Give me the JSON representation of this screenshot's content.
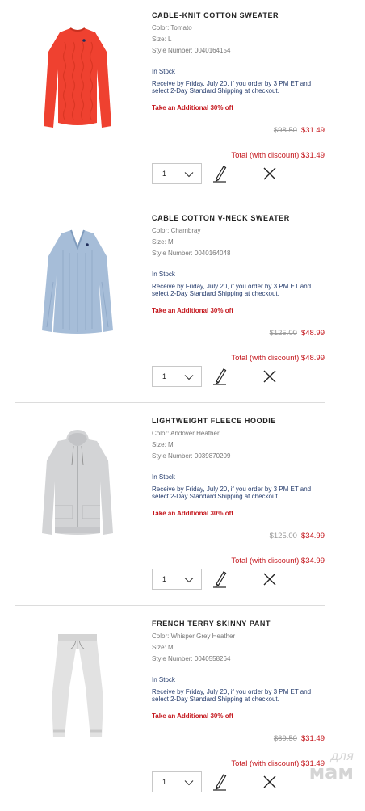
{
  "cart": {
    "items": [
      {
        "title": "CABLE-KNIT COTTON SWEATER",
        "color": "Color: Tomato",
        "size": "Size: L",
        "style": "Style Number: 0040164154",
        "stock": "In Stock",
        "shipping": "Receive by Friday, July 20, if you order by 3 PM ET and select 2-Day Standard Shipping at checkout.",
        "promo": "Take an Additional 30% off",
        "original_price": "$98.50",
        "sale_price": "$31.49",
        "total": "Total (with discount) $31.49",
        "quantity": "1",
        "image_color": "#ef4130",
        "image_icon": "sweater-red"
      },
      {
        "title": "CABLE COTTON V-NECK SWEATER",
        "color": "Color: Chambray",
        "size": "Size: M",
        "style": "Style Number: 0040164048",
        "stock": "In Stock",
        "shipping": "Receive by Friday, July 20, if you order by 3 PM ET and select 2-Day Standard Shipping at checkout.",
        "promo": "Take an Additional 30% off",
        "original_price": "$125.00",
        "sale_price": "$48.99",
        "total": "Total (with discount) $48.99",
        "quantity": "1",
        "image_color": "#a6bdd8",
        "image_icon": "vneck-sweater"
      },
      {
        "title": "LIGHTWEIGHT FLEECE HOODIE",
        "color": "Color: Andover Heather",
        "size": "Size: M",
        "style": "Style Number: 0039870209",
        "stock": "In Stock",
        "shipping": "Receive by Friday, July 20, if you order by 3 PM ET and select 2-Day Standard Shipping at checkout.",
        "promo": "Take an Additional 30% off",
        "original_price": "$125.00",
        "sale_price": "$34.99",
        "total": "Total (with discount) $34.99",
        "quantity": "1",
        "image_color": "#d3d4d6",
        "image_icon": "hoodie"
      },
      {
        "title": "FRENCH TERRY SKINNY PANT",
        "color": "Color: Whisper Grey Heather",
        "size": "Size: M",
        "style": "Style Number: 0040558264",
        "stock": "In Stock",
        "shipping": "Receive by Friday, July 20, if you order by 3 PM ET and select 2-Day Standard Shipping at checkout.",
        "promo": "Take an Additional 30% off",
        "original_price": "$69.50",
        "sale_price": "$31.49",
        "total": "Total (with discount) $31.49",
        "quantity": "1",
        "image_color": "#e2e2e2",
        "image_icon": "pants"
      }
    ]
  },
  "watermark": {
    "line1": "для",
    "line2": "мам"
  }
}
